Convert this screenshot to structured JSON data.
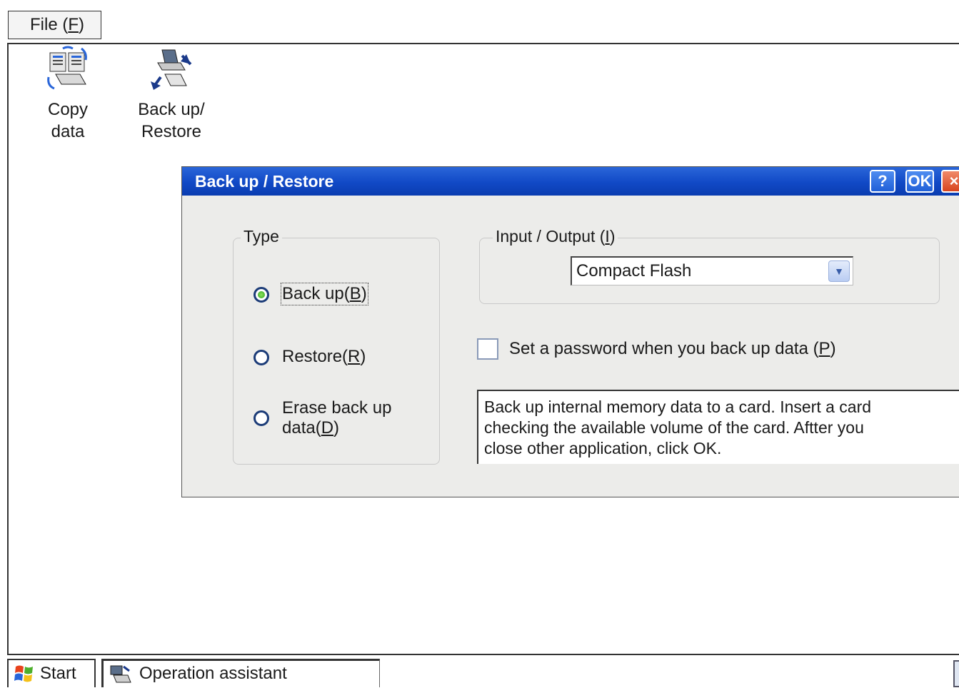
{
  "menubar": {
    "file_label": "File (",
    "file_key": "F",
    "file_suffix": ")"
  },
  "desktop": {
    "icons": [
      {
        "label": "Copy\ndata",
        "icon": "copy-data-icon"
      },
      {
        "label": "Back up/\nRestore",
        "icon": "backup-restore-icon"
      }
    ]
  },
  "dialog": {
    "title": "Back up / Restore",
    "help_label": "?",
    "ok_label": "OK",
    "close_label": "×",
    "type_group": {
      "legend": "Type",
      "options": [
        {
          "label": "Back up(",
          "key": "B",
          "suffix": ")",
          "checked": true
        },
        {
          "label": "Restore(",
          "key": "R",
          "suffix": ")",
          "checked": false
        },
        {
          "label": "Erase back up\ndata(",
          "key": "D",
          "suffix": ")",
          "checked": false
        }
      ]
    },
    "io_group": {
      "legend": "Input / Output (",
      "legend_key": "I",
      "legend_suffix": ")",
      "selected": "Compact Flash"
    },
    "password_checkbox": {
      "label": "Set a password when you back up data (",
      "key": "P",
      "suffix": ")",
      "checked": false
    },
    "info_text": "Back up  internal memory data to a card.  Insert a card\nchecking the available volume of the card.  Aftter you\nclose other application, click OK."
  },
  "taskbar": {
    "start_label": "Start",
    "task_label": "Operation assistant"
  },
  "colors": {
    "title_blue": "#1149c6",
    "radio_green": "#2ea61d"
  }
}
